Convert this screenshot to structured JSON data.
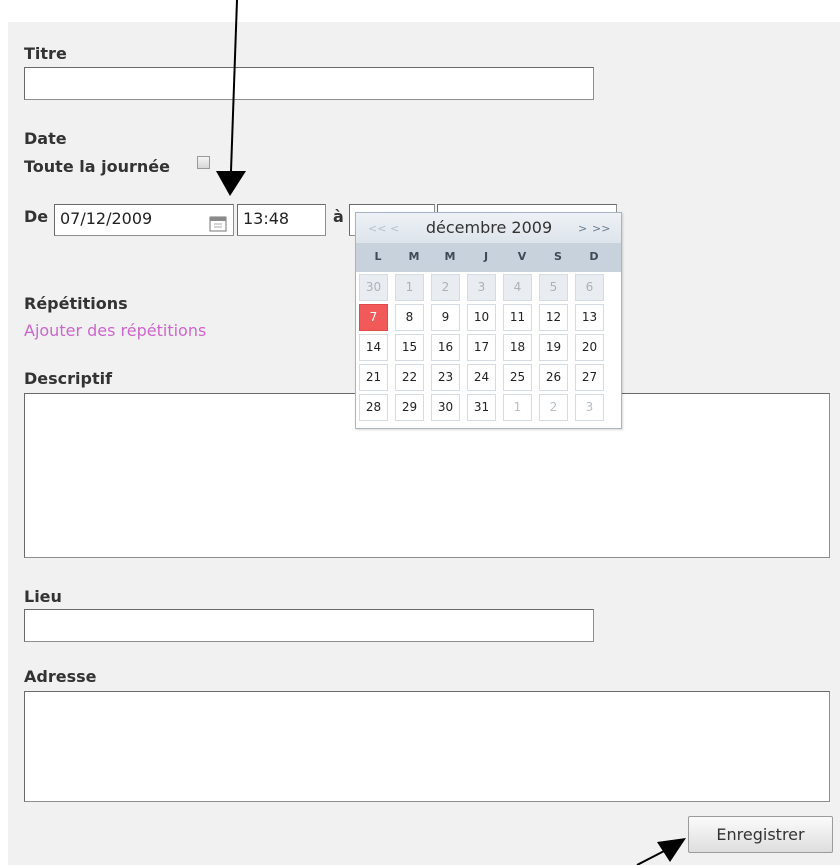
{
  "form": {
    "title_label": "Titre",
    "title_value": "",
    "date_label": "Date",
    "allday_label": "Toute la journée",
    "from_label": "De",
    "from_date": "07/12/2009",
    "from_time": "13:48",
    "to_label": "à",
    "repetitions_label": "Répétitions",
    "add_repetitions_link": "Ajouter des répétitions",
    "description_label": "Descriptif",
    "place_label": "Lieu",
    "address_label": "Adresse",
    "save_label": "Enregistrer"
  },
  "calendar": {
    "prev_year": "<<",
    "prev_month": "<",
    "title": "décembre 2009",
    "next_month": ">",
    "next_year": ">>",
    "weekdays": [
      "L",
      "M",
      "M",
      "J",
      "V",
      "S",
      "D"
    ],
    "weeks": [
      [
        "30",
        "1",
        "2",
        "3",
        "4",
        "5",
        "6"
      ],
      [
        "7",
        "8",
        "9",
        "10",
        "11",
        "12",
        "13"
      ],
      [
        "14",
        "15",
        "16",
        "17",
        "18",
        "19",
        "20"
      ],
      [
        "21",
        "22",
        "23",
        "24",
        "25",
        "26",
        "27"
      ],
      [
        "28",
        "29",
        "30",
        "31",
        "1",
        "2",
        "3"
      ]
    ],
    "today": "7",
    "colors": {
      "today": "#f25a5a",
      "header": "#c8d2dc",
      "link": "#cc66cc"
    }
  }
}
